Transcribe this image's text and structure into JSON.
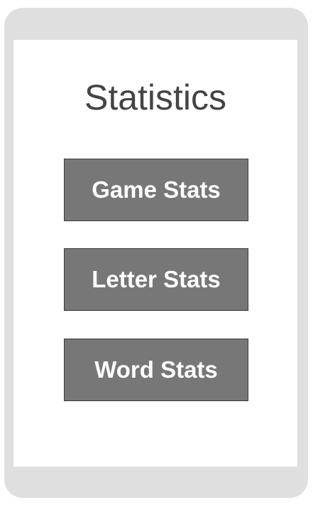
{
  "page": {
    "title": "Statistics"
  },
  "buttons": {
    "game_stats": "Game Stats",
    "letter_stats": "Letter Stats",
    "word_stats": "Word Stats"
  },
  "colors": {
    "frame": "#dfdfdf",
    "screen": "#ffffff",
    "title_text": "#444444",
    "button_bg": "#777777",
    "button_text": "#ffffff"
  }
}
